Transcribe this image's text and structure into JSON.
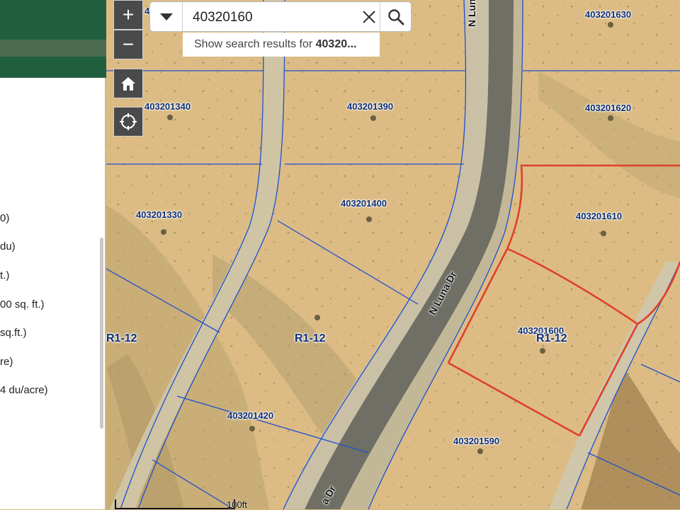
{
  "panel": {
    "rows": [
      "0)",
      "du)",
      "t.)",
      "00 sq. ft.)",
      "sq.ft.)",
      "re)",
      "4 du/acre)"
    ]
  },
  "controls": {
    "zoom_in": "+",
    "zoom_out": "−"
  },
  "search": {
    "value": "40320160",
    "suggest_prefix": "Show search results for ",
    "suggest_term": "40320..."
  },
  "parcels": {
    "p1630": "403201630",
    "p1340": "403201340",
    "p1390": "403201390",
    "p1620": "403201620",
    "p1330": "403201330",
    "p1400": "403201400",
    "p1610": "403201610",
    "p1600": "403201600",
    "p1420": "403201420",
    "p1590": "403201590",
    "p_top_left": "4"
  },
  "zones": {
    "left": "R1-12",
    "center": "R1-12",
    "right": "R1-12"
  },
  "roads": {
    "top": "N Luna Dr",
    "middle": "N Luna Dr",
    "bottom": "a Dr"
  },
  "scale": {
    "label": "100ft"
  },
  "colors": {
    "header_green": "#1f5f3f",
    "parcel_line": "#1f4fcf",
    "highlight": "#e0402a"
  }
}
